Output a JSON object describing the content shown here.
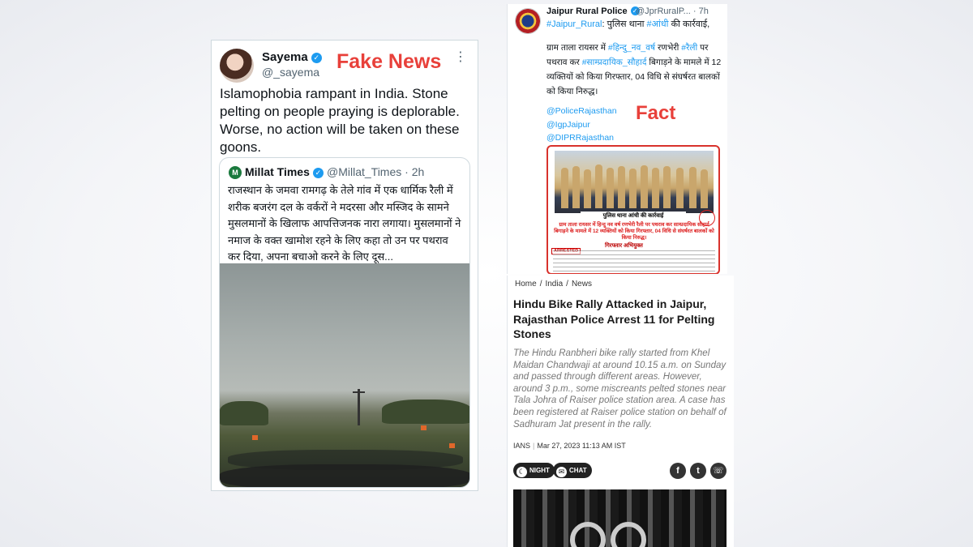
{
  "fake_tweet": {
    "label": "Fake News",
    "name": "Sayema",
    "handle": "@_sayema",
    "text": "Islamophobia rampant in India. Stone pelting on people praying is deplorable. Worse, no action will be taken on these goons.",
    "quote": {
      "name": "Millat Times",
      "handle": "@Millat_Times · 2h",
      "text": "राजस्थान के जमवा रामगढ़ के तेले गांव में एक धार्मिक रैली में शरीक बजरंग दल के वर्करों ने मदरसा और मस्जिद के सामने मुसलमानों के खिलाफ आपत्तिजनक नारा लगाया। मुसलमानों ने नमाज के वक्त खामोश रहने के लिए कहा तो उन पर पथराव कर दिया, अपना बचाओ करने के लिए दूस..."
    }
  },
  "fact_tweet": {
    "label": "Fact",
    "name": "Jaipur Rural Police",
    "handle": "@JprRuralP... · 7h",
    "line1_tag": "#Jaipur_Rural",
    "line1_text": ": पुलिस थाना ",
    "line1_tag2": "#आंधी",
    "line1_end": " की कार्रवाई,",
    "body_a": "ग्राम ताला रायसर में ",
    "body_tag1": "#हिन्दु_नव_वर्ष",
    "body_b": " रणभेरी ",
    "body_tag2": "#रैली",
    "body_c": " पर पथराव कर ",
    "body_tag3": "#साम्प्रदायिक_सौहार्द",
    "body_d": " बिगाड़ने के मामले में 12 व्यक्तियों को किया गिरफ्तार, 04 विधि से संघर्षरत बालकों को किया निरुद्ध।",
    "mentions": [
      "@PoliceRajasthan",
      "@IgpJaipur",
      "@DIPRRajasthan"
    ],
    "poster": {
      "caption": "पुलिस थाना आंधी की कार्रवाई",
      "red_text": "ग्राम ताला रायसर में हिन्दु नव वर्ष रणभेरी रैली पर पथराव कर साम्प्रदायिक सौहार्द बिगाड़ने के मामले में 12 व्यक्तियों को किया गिरफ्तार, 04 विधि से संघर्षरत बालकों को किया निरुद्ध।",
      "sub": "गिरफ्तार अभियुक्त",
      "tag": "ARRESTED"
    }
  },
  "article": {
    "breadcrumb": [
      "Home",
      "/",
      "India",
      "/",
      "News"
    ],
    "headline": "Hindu Bike Rally Attacked in Jaipur, Rajasthan Police Arrest 11 for Pelting Stones",
    "lede": "The Hindu Ranbheri bike rally started from Khel Maidan Chandwaji at around 10.15 a.m. on Sunday and passed through different areas. However, around 3 p.m., some miscreants pelted stones near Tala Johra of Raiser police station area. A case has been registered at Raiser police station on behalf of Sadhuram Jat present in the rally.",
    "source": "IANS",
    "date": "Mar 27, 2023 11:13 AM IST",
    "night_label": "NIGHT",
    "chat_label": "CHAT",
    "share_icons": [
      "facebook-icon",
      "twitter-icon",
      "whatsapp-icon"
    ]
  },
  "colors": {
    "label_red": "#e8403a",
    "link_blue": "#1d9bf0"
  }
}
